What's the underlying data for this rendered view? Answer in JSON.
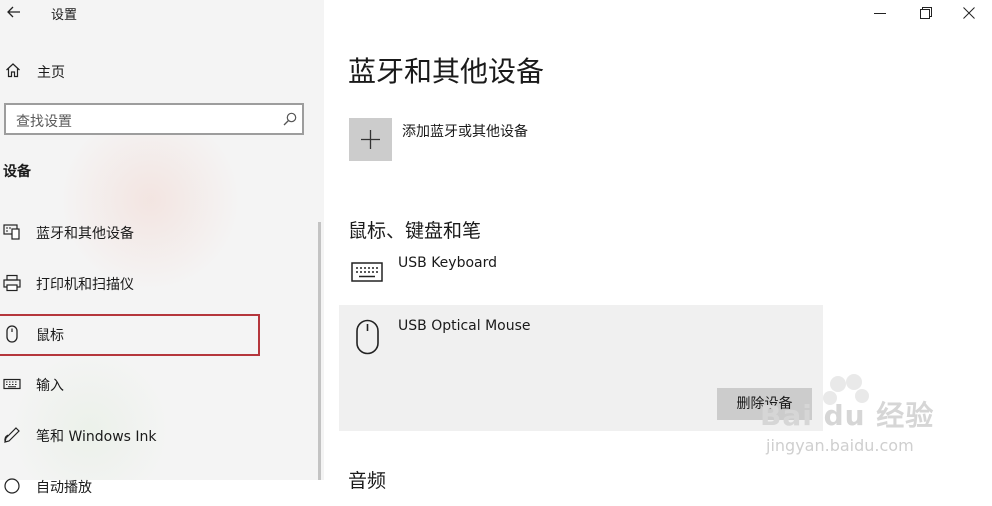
{
  "window": {
    "title": "设置",
    "controls": [
      "minimize-icon",
      "restore-icon",
      "close-icon"
    ]
  },
  "sidebar": {
    "home_label": "主页",
    "search_placeholder": "查找设置",
    "section_header": "设备",
    "items": [
      {
        "label": "蓝牙和其他设备",
        "icon": "bluetooth-devices-icon"
      },
      {
        "label": "打印机和扫描仪",
        "icon": "printer-icon"
      },
      {
        "label": "鼠标",
        "icon": "mouse-icon",
        "selected": true
      },
      {
        "label": "输入",
        "icon": "keyboard-icon"
      },
      {
        "label": "笔和 Windows Ink",
        "icon": "pen-icon"
      },
      {
        "label": "自动播放",
        "icon": "autoplay-icon"
      }
    ]
  },
  "main": {
    "title": "蓝牙和其他设备",
    "add_device_label": "添加蓝牙或其他设备",
    "section_input": "鼠标、键盘和笔",
    "devices": [
      {
        "name": "USB Keyboard",
        "icon": "keyboard-icon"
      },
      {
        "name": "USB Optical Mouse",
        "icon": "mouse-icon"
      }
    ],
    "remove_button": "删除设备",
    "section_audio": "音频"
  },
  "watermark": {
    "brand": "Bai du 经验",
    "url": "jingyan.baidu.com"
  },
  "colors": {
    "sidebar_bg": "#f4f4f4",
    "selection_border": "#b5363c",
    "card_bg": "#f0f0f0",
    "button_bg": "#cccccc"
  }
}
